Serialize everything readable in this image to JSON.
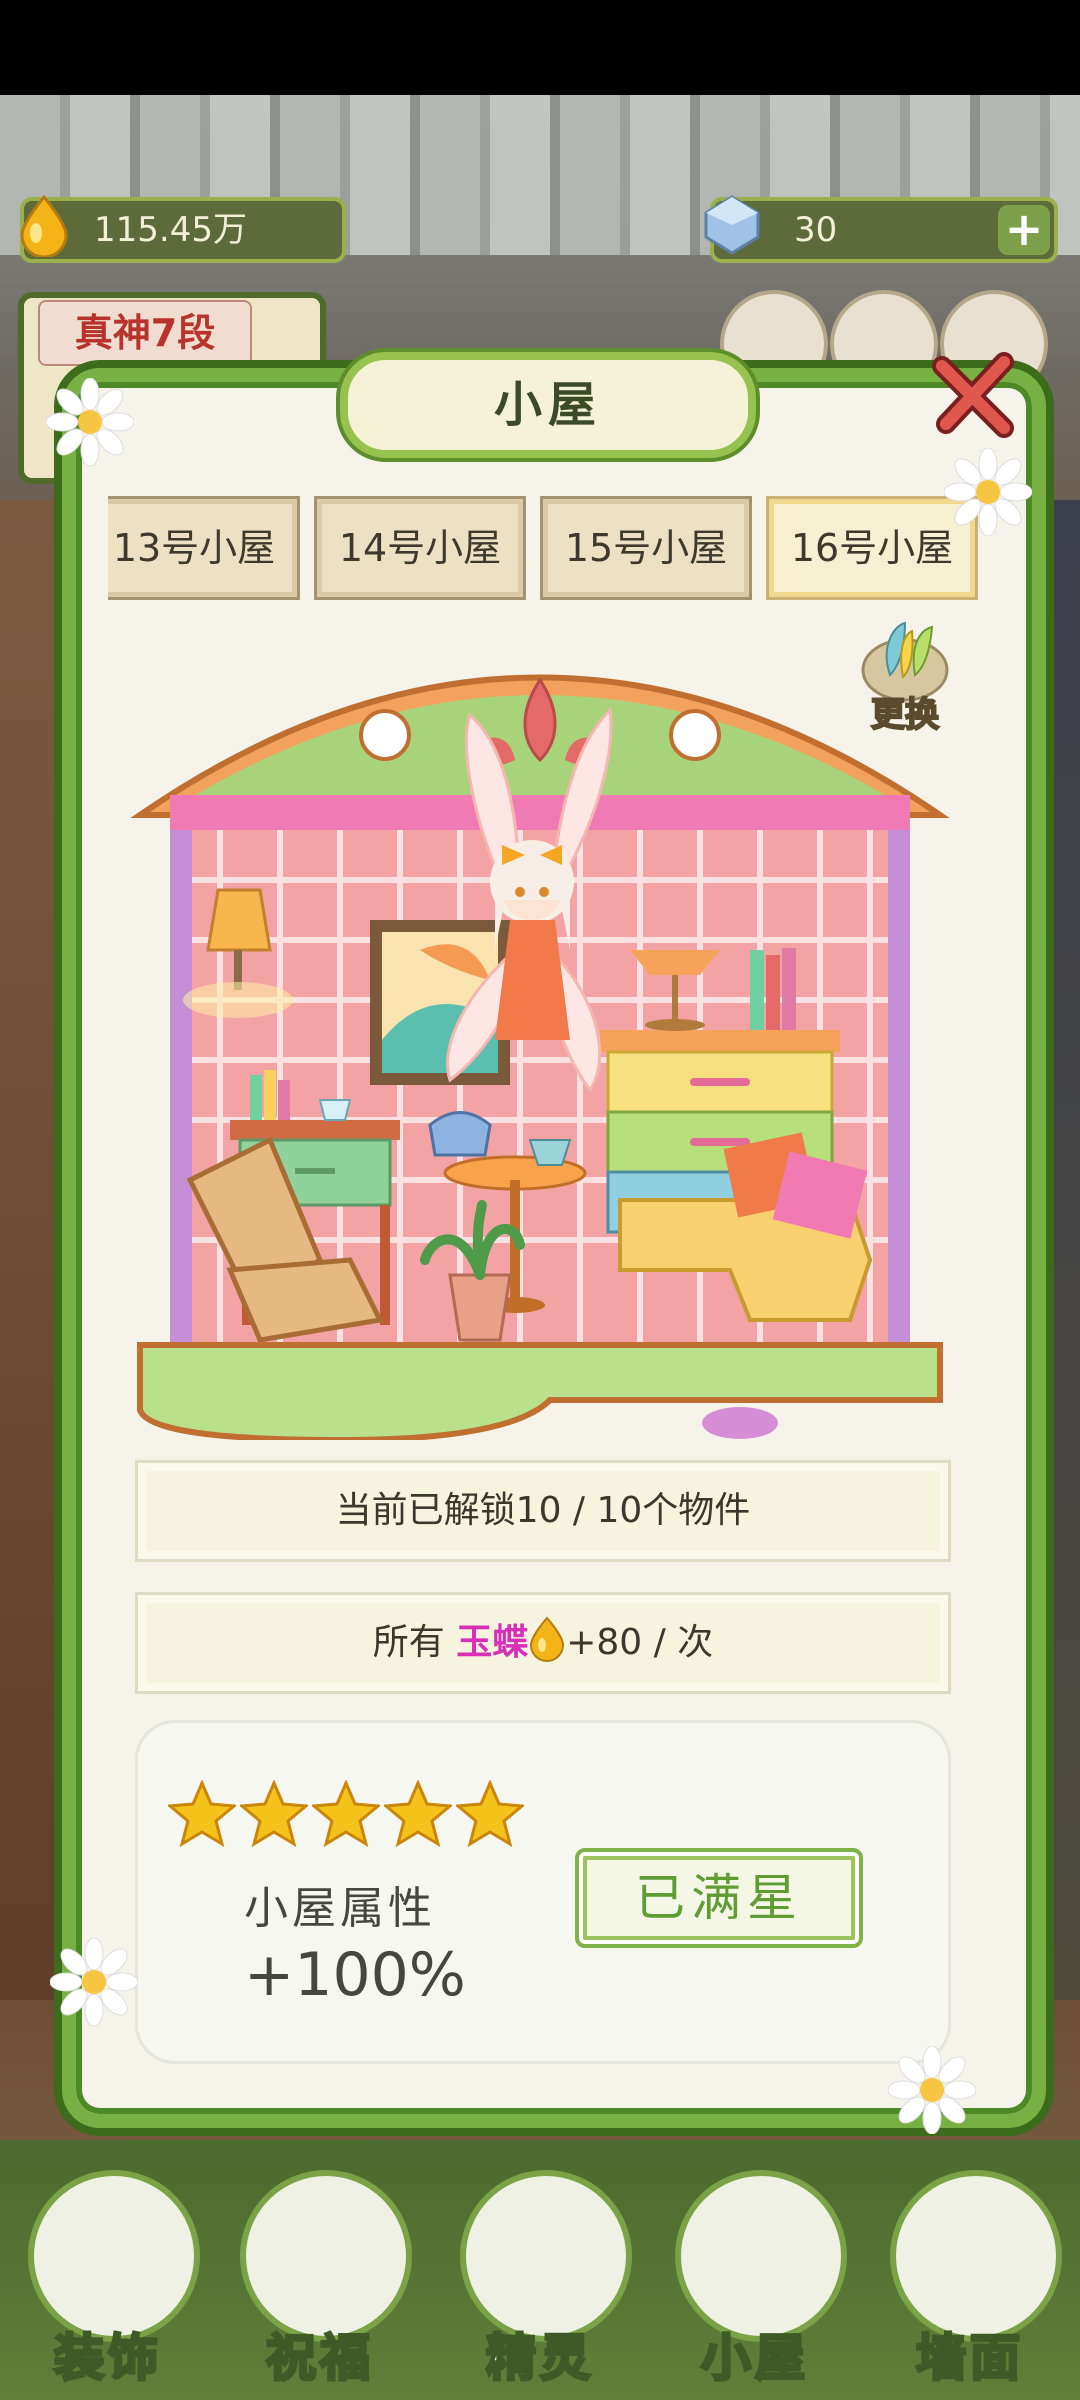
{
  "resources": {
    "drops": {
      "value": "115.45万",
      "icon": "water-drop-icon"
    },
    "gems": {
      "value": "30",
      "icon": "gem-icon",
      "add_label": "+"
    }
  },
  "rank": {
    "label": "真神7段"
  },
  "modal": {
    "title": "小屋",
    "tabs": [
      {
        "label": "13号小屋",
        "active": false
      },
      {
        "label": "14号小屋",
        "active": false
      },
      {
        "label": "15号小屋",
        "active": false
      },
      {
        "label": "16号小屋",
        "active": true
      }
    ],
    "change_label": "更换",
    "unlock_text": "当前已解锁10 / 10个物件",
    "bonus": {
      "prefix": "所有 ",
      "name": "玉蝶",
      "suffix": "+80 / 次"
    },
    "rating": {
      "stars": 5,
      "max": 5
    },
    "property_label": "小屋属性",
    "property_value": "+100%",
    "max_star_label": "已满星"
  },
  "bottom_nav": [
    {
      "label": "装饰",
      "icon": "plant-icon"
    },
    {
      "label": "祝福",
      "icon": "butterfly-icon"
    },
    {
      "label": "精灵",
      "icon": "fairy-icon"
    },
    {
      "label": "小屋",
      "icon": "house-icon"
    },
    {
      "label": "墙面",
      "icon": "bell-icon"
    }
  ],
  "colors": {
    "accent_green": "#77b043",
    "magenta": "#d82fb8",
    "star": "#f5c21b"
  }
}
